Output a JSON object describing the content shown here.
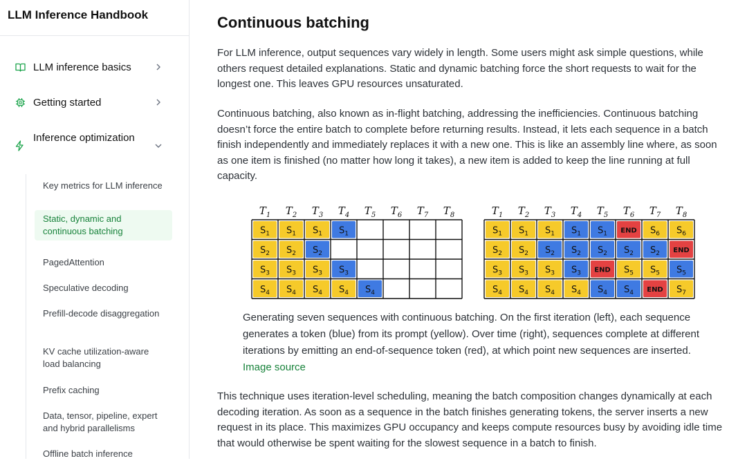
{
  "sidebar": {
    "title": "LLM Inference Handbook",
    "items": [
      {
        "label": "LLM inference basics",
        "icon": "book-icon"
      },
      {
        "label": "Getting started",
        "icon": "chip-icon"
      },
      {
        "label": "Inference optimization",
        "icon": "zap-icon"
      }
    ],
    "subitems": [
      "Key metrics for LLM inference",
      "Static, dynamic and continuous batching",
      "PagedAttention",
      "Speculative decoding",
      "Prefill-decode disaggregation",
      "KV cache utilization-aware load balancing",
      "Prefix caching",
      "Data, tensor, pipeline, expert and hybrid parallelisms",
      "Offline batch inference"
    ],
    "active_subitem": "Static, dynamic and continuous batching"
  },
  "content": {
    "title": "Continuous batching",
    "paragraphs": [
      "For LLM inference, output sequences vary widely in length. Some users might ask simple questions, while others request detailed explanations. Static and dynamic batching force the short requests to wait for the longest one. This leaves GPU resources unsaturated.",
      "Continuous batching, also known as in-flight batching, addressing the inefficiencies. Continuous batching doesn’t force the entire batch to complete before returning results. Instead, it lets each sequence in a batch finish independently and immediately replaces it with a new one. This is like an assembly line where, as soon as one item is finished (no matter how long it takes), a new item is added to keep the line running at full capacity.",
      "This technique uses iteration-level scheduling, meaning the batch composition changes dynamically at each decoding iteration. As soon as a sequence in the batch finishes generating tokens, the server inserts a new request in its place. This maximizes GPU occupancy and keeps compute resources busy by avoiding idle time that would otherwise be spent waiting for the slowest sequence in a batch to finish."
    ],
    "caption": "Generating seven sequences with continuous batching. On the first iteration (left), each sequence generates a token (blue) from its prompt (yellow). Over time (right), sequences complete at different iterations by emitting an end-of-sequence token (red), at which point new sequences are inserted.",
    "caption_link": "Image source"
  },
  "figure": {
    "columns": [
      "T1",
      "T2",
      "T3",
      "T4",
      "T5",
      "T6",
      "T7",
      "T8"
    ],
    "colors": {
      "prompt": "#f5c518",
      "generated": "#2f6fe0",
      "end": "#e23232",
      "empty": "#ffffff"
    },
    "left_grid": [
      [
        [
          "prompt",
          "S1"
        ],
        [
          "prompt",
          "S1"
        ],
        [
          "prompt",
          "S1"
        ],
        [
          "generated",
          "S1"
        ],
        [
          "empty",
          ""
        ],
        [
          "empty",
          ""
        ],
        [
          "empty",
          ""
        ],
        [
          "empty",
          ""
        ]
      ],
      [
        [
          "prompt",
          "S2"
        ],
        [
          "prompt",
          "S2"
        ],
        [
          "generated",
          "S2"
        ],
        [
          "empty",
          ""
        ],
        [
          "empty",
          ""
        ],
        [
          "empty",
          ""
        ],
        [
          "empty",
          ""
        ],
        [
          "empty",
          ""
        ]
      ],
      [
        [
          "prompt",
          "S3"
        ],
        [
          "prompt",
          "S3"
        ],
        [
          "prompt",
          "S3"
        ],
        [
          "generated",
          "S3"
        ],
        [
          "empty",
          ""
        ],
        [
          "empty",
          ""
        ],
        [
          "empty",
          ""
        ],
        [
          "empty",
          ""
        ]
      ],
      [
        [
          "prompt",
          "S4"
        ],
        [
          "prompt",
          "S4"
        ],
        [
          "prompt",
          "S4"
        ],
        [
          "prompt",
          "S4"
        ],
        [
          "generated",
          "S4"
        ],
        [
          "empty",
          ""
        ],
        [
          "empty",
          ""
        ],
        [
          "empty",
          ""
        ]
      ]
    ],
    "right_grid": [
      [
        [
          "prompt",
          "S1"
        ],
        [
          "prompt",
          "S1"
        ],
        [
          "prompt",
          "S1"
        ],
        [
          "generated",
          "S1"
        ],
        [
          "generated",
          "S1"
        ],
        [
          "end",
          "END"
        ],
        [
          "prompt",
          "S6"
        ],
        [
          "prompt",
          "S6"
        ]
      ],
      [
        [
          "prompt",
          "S2"
        ],
        [
          "prompt",
          "S2"
        ],
        [
          "generated",
          "S2"
        ],
        [
          "generated",
          "S2"
        ],
        [
          "generated",
          "S2"
        ],
        [
          "generated",
          "S2"
        ],
        [
          "generated",
          "S2"
        ],
        [
          "end",
          "END"
        ]
      ],
      [
        [
          "prompt",
          "S3"
        ],
        [
          "prompt",
          "S3"
        ],
        [
          "prompt",
          "S3"
        ],
        [
          "generated",
          "S3"
        ],
        [
          "end",
          "END"
        ],
        [
          "prompt",
          "S5"
        ],
        [
          "prompt",
          "S5"
        ],
        [
          "generated",
          "S5"
        ]
      ],
      [
        [
          "prompt",
          "S4"
        ],
        [
          "prompt",
          "S4"
        ],
        [
          "prompt",
          "S4"
        ],
        [
          "prompt",
          "S4"
        ],
        [
          "generated",
          "S4"
        ],
        [
          "generated",
          "S4"
        ],
        [
          "end",
          "END"
        ],
        [
          "prompt",
          "S7"
        ]
      ]
    ]
  }
}
